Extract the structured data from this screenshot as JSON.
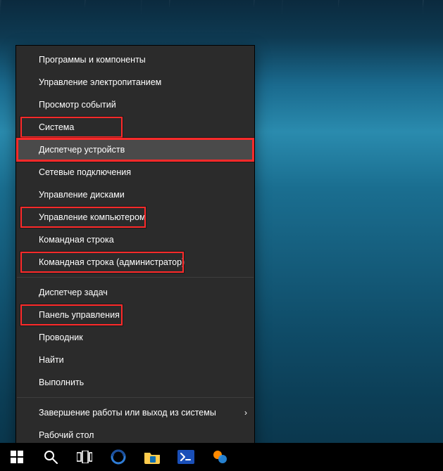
{
  "menu": {
    "groups": [
      [
        {
          "id": "programs-features",
          "label": "Программы и компоненты",
          "hover": false,
          "hl": false
        },
        {
          "id": "power-options",
          "label": "Управление электропитанием",
          "hover": false,
          "hl": false
        },
        {
          "id": "event-viewer",
          "label": "Просмотр событий",
          "hover": false,
          "hl": false
        },
        {
          "id": "system",
          "label": "Система",
          "hover": false,
          "hl": true,
          "hlWidth": 145
        },
        {
          "id": "device-manager",
          "label": "Диспетчер устройств",
          "hover": true,
          "hl": true,
          "hlWidth": 160,
          "hlFull": true
        },
        {
          "id": "network-connections",
          "label": "Сетевые подключения",
          "hover": false,
          "hl": false
        },
        {
          "id": "disk-mgmt",
          "label": "Управление дисками",
          "hover": false,
          "hl": false
        },
        {
          "id": "computer-mgmt",
          "label": "Управление компьютером",
          "hover": false,
          "hl": true,
          "hlWidth": 178
        },
        {
          "id": "cmd",
          "label": "Командная строка",
          "hover": false,
          "hl": false
        },
        {
          "id": "cmd-admin",
          "label": "Командная строка (администратор)",
          "hover": false,
          "hl": true,
          "hlWidth": 232
        }
      ],
      [
        {
          "id": "task-mgr",
          "label": "Диспетчер задач",
          "hover": false,
          "hl": false
        },
        {
          "id": "control-panel",
          "label": "Панель управления",
          "hover": false,
          "hl": true,
          "hlWidth": 145
        },
        {
          "id": "explorer",
          "label": "Проводник",
          "hover": false,
          "hl": false
        },
        {
          "id": "search",
          "label": "Найти",
          "hover": false,
          "hl": false
        },
        {
          "id": "run",
          "label": "Выполнить",
          "hover": false,
          "hl": false
        }
      ],
      [
        {
          "id": "shutdown",
          "label": "Завершение работы или выход из системы",
          "hover": false,
          "hl": false,
          "submenu": true
        },
        {
          "id": "desktop",
          "label": "Рабочий стол",
          "hover": false,
          "hl": false
        }
      ]
    ]
  },
  "taskbar": {
    "buttons": [
      {
        "id": "start",
        "name": "start-button",
        "icon": "windows"
      },
      {
        "id": "search",
        "name": "search-button",
        "icon": "search"
      },
      {
        "id": "taskview",
        "name": "task-view-button",
        "icon": "taskview"
      },
      {
        "id": "edge",
        "name": "edge-browser",
        "icon": "edge"
      },
      {
        "id": "explorer",
        "name": "file-explorer",
        "icon": "explorer"
      },
      {
        "id": "powershell",
        "name": "powershell",
        "icon": "ps"
      },
      {
        "id": "extra",
        "name": "extra-app",
        "icon": "extra"
      }
    ]
  },
  "colors": {
    "highlight": "#ff2a2a",
    "menuBg": "#2b2b2b",
    "menuHover": "#4a4a4a"
  }
}
